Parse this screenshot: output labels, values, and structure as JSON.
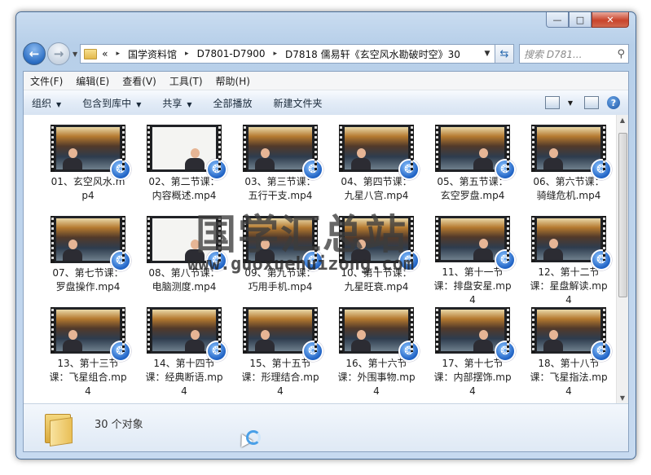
{
  "window": {
    "buttons": {
      "minimize": "—",
      "maximize": "□",
      "close": "✕"
    }
  },
  "nav": {
    "back_glyph": "←",
    "forward_glyph": "→",
    "address": {
      "prefix": "«",
      "crumbs": [
        "国学资料馆",
        "D7801-D7900",
        "D7818 儒易轩《玄空风水勘破时空》30"
      ],
      "separator": "▸"
    },
    "refresh_glyph": "⇆",
    "search_placeholder": "搜索 D781..."
  },
  "menubar": [
    "文件(F)",
    "编辑(E)",
    "查看(V)",
    "工具(T)",
    "帮助(H)"
  ],
  "toolbar": {
    "items": [
      {
        "label": "组织",
        "dropdown": true
      },
      {
        "label": "包含到库中",
        "dropdown": true
      },
      {
        "label": "共享",
        "dropdown": true
      },
      {
        "label": "全部播放",
        "dropdown": false
      },
      {
        "label": "新建文件夹",
        "dropdown": false
      }
    ],
    "help_glyph": "?"
  },
  "files": [
    {
      "name": "01、玄空风水.mp4",
      "thumb": "stage"
    },
    {
      "name": "02、第二节课：内容概述.mp4",
      "thumb": "white"
    },
    {
      "name": "03、第三节课：五行干支.mp4",
      "thumb": "stage"
    },
    {
      "name": "04、第四节课：九星八宫.mp4",
      "thumb": "stage"
    },
    {
      "name": "05、第五节课：玄空罗盘.mp4",
      "thumb": "stage"
    },
    {
      "name": "06、第六节课：骑缝危机.mp4",
      "thumb": "stage"
    },
    {
      "name": "07、第七节课：罗盘操作.mp4",
      "thumb": "stage"
    },
    {
      "name": "08、第八节课：电脑测度.mp4",
      "thumb": "white"
    },
    {
      "name": "09、第九节课：巧用手机.mp4",
      "thumb": "stage"
    },
    {
      "name": "10、第十节课：九星旺衰.mp4",
      "thumb": "stage"
    },
    {
      "name": "11、第十一节课：排盘安星.mp4",
      "thumb": "stage"
    },
    {
      "name": "12、第十二节课：星盘解读.mp4",
      "thumb": "stage"
    },
    {
      "name": "13、第十三节课：飞星组合.mp4",
      "thumb": "stage"
    },
    {
      "name": "14、第十四节课：经典断语.mp4",
      "thumb": "stage"
    },
    {
      "name": "15、第十五节课：形理结合.mp4",
      "thumb": "stage"
    },
    {
      "name": "16、第十六节课：外围事物.mp4",
      "thumb": "stage"
    },
    {
      "name": "17、第十七节课：内部摆饰.mp4",
      "thumb": "stage"
    },
    {
      "name": "18、第十八节课：飞星指法.mp4",
      "thumb": "stage"
    }
  ],
  "details": {
    "count_text": "30 个对象"
  },
  "watermark": {
    "title": "国学汇总站",
    "url": "www.guoxuehuizong.com"
  }
}
